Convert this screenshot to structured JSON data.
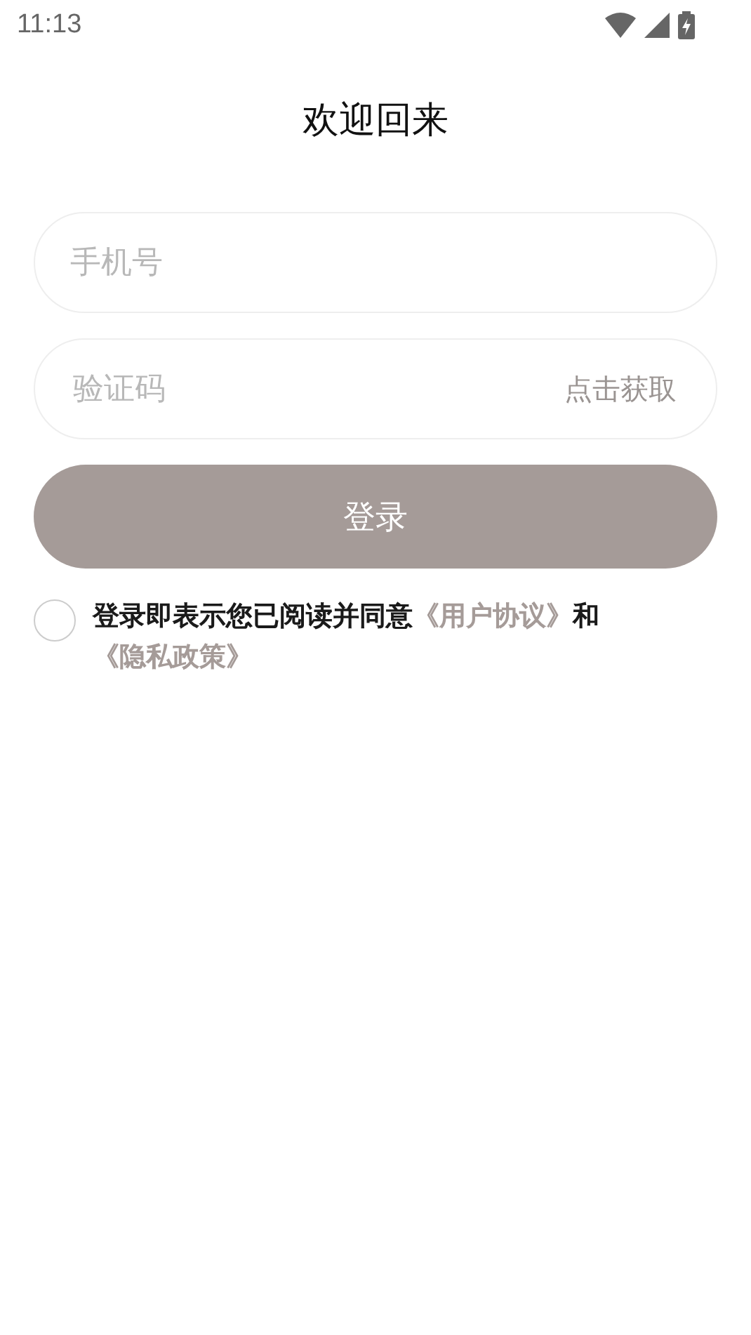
{
  "status_bar": {
    "time": "11:13"
  },
  "title": "欢迎回来",
  "phone_field": {
    "placeholder": "手机号"
  },
  "code_field": {
    "placeholder": "验证码",
    "action": "点击获取"
  },
  "login_button": {
    "label": "登录",
    "disabled": true
  },
  "agreement": {
    "checked": false,
    "parts": [
      {
        "kind": "text",
        "text": "登录即表示您已阅读并同意"
      },
      {
        "kind": "link",
        "text": "《用户协议》"
      },
      {
        "kind": "text",
        "text": "和"
      },
      {
        "kind": "link",
        "text": "《隐私政策》"
      }
    ]
  }
}
